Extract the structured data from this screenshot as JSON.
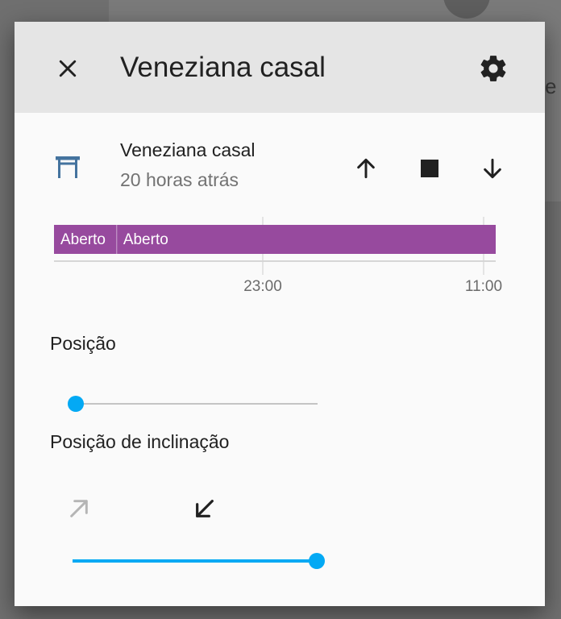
{
  "dialog": {
    "title": "Veneziana casal"
  },
  "entity": {
    "name": "Veneziana casal",
    "last_changed": "20 horas atrás",
    "icon": "window-shutter-icon"
  },
  "controls": {
    "up_icon": "arrow-up-icon",
    "stop_icon": "stop-icon",
    "down_icon": "arrow-down-icon"
  },
  "history": {
    "segments": [
      {
        "state": "Aberto",
        "start": 0.0,
        "end": 0.142
      },
      {
        "state": "Aberto",
        "start": 0.142,
        "end": 1.0
      }
    ],
    "ticks": [
      "23:00",
      "11:00"
    ],
    "bar_color": "#974a9e"
  },
  "position": {
    "label": "Posição",
    "value_percent": 0
  },
  "tilt": {
    "label": "Posição de inclinação",
    "open_icon": "arrow-top-right-icon",
    "close_icon": "arrow-bottom-left-icon",
    "value_percent": 100
  },
  "colors": {
    "accent": "#03a9f4",
    "header_bg": "#e5e5e5",
    "icon_blue": "#44739e"
  }
}
